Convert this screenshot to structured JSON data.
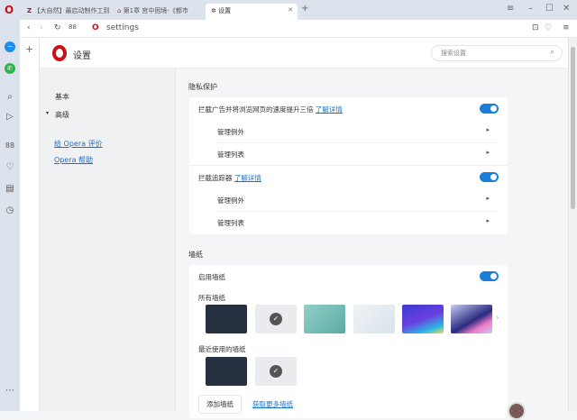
{
  "tabs": [
    {
      "label": "【大自然】最启动制作工到"
    },
    {
      "label": "第1章 宫中困境-《都市"
    },
    {
      "label": "设置"
    }
  ],
  "address": {
    "url": "settings"
  },
  "header": {
    "title": "设置",
    "search_placeholder": "搜索设置"
  },
  "nav": {
    "basic": "基本",
    "advanced": "高级",
    "rate": "给 Opera 评价",
    "help": "Opera 帮助"
  },
  "privacy": {
    "title": "隐私保护",
    "adblock_label": "拦截广告并将浏览网页的速度提升三倍",
    "adblock_link": "了解详情",
    "adblock_on": true,
    "manage_exceptions": "管理例外",
    "manage_lists": "管理列表",
    "tracker_label": "拦截追踪器",
    "tracker_link": "了解详情",
    "tracker_on": true
  },
  "wallpaper": {
    "title": "墙纸",
    "enable": "启用墙纸",
    "enable_on": true,
    "all": "所有墙纸",
    "recent": "最近使用的墙纸",
    "add": "添加墙纸",
    "more": "获取更多墙纸"
  },
  "colors": {
    "accent": "#1a7fd8",
    "brand": "#cc0f16"
  }
}
